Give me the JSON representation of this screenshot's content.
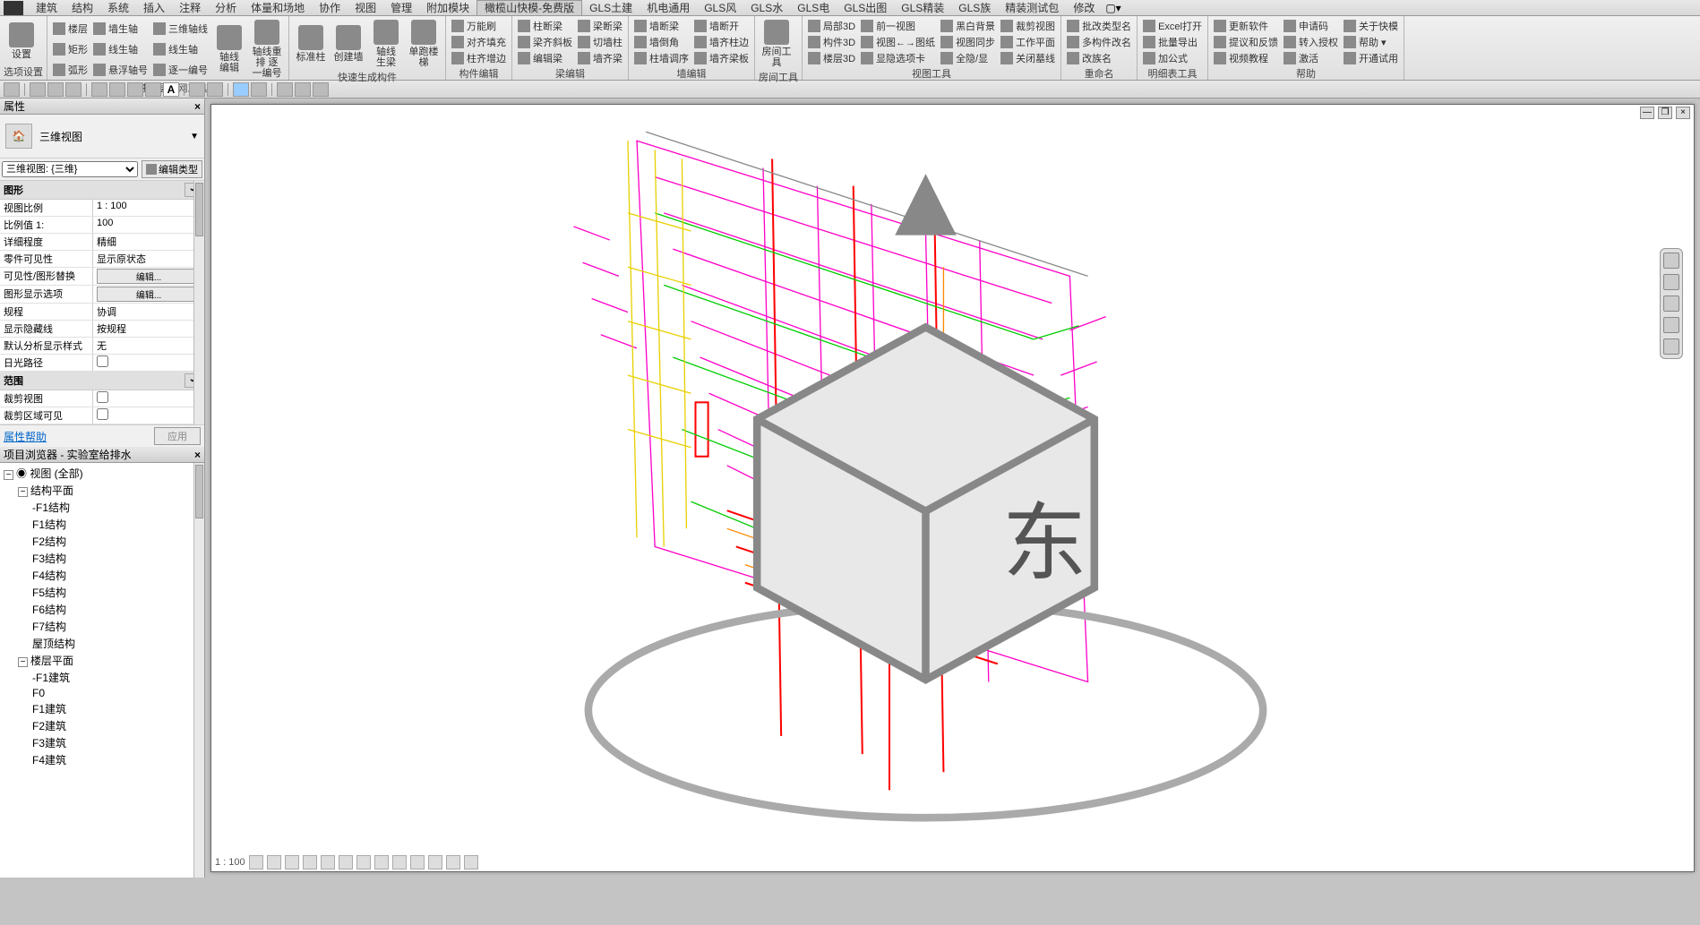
{
  "tabs": [
    "建筑",
    "结构",
    "系统",
    "插入",
    "注释",
    "分析",
    "体量和场地",
    "协作",
    "视图",
    "管理",
    "附加模块",
    "橄榄山快模-免费版",
    "GLS土建",
    "机电通用",
    "GLS风",
    "GLS水",
    "GLS电",
    "GLS出图",
    "GLS精装",
    "GLS族",
    "精装测试包",
    "修改"
  ],
  "active_tab": 11,
  "overflow": "▢▾",
  "ribbon": {
    "g1": {
      "label": "选项设置",
      "big": {
        "label": "设置"
      }
    },
    "g2": {
      "label": "快速楼层轴网工具",
      "c1": [
        "楼层",
        "矩形",
        "弧形"
      ],
      "c2": [
        "墙生轴",
        "线生轴",
        "悬浮轴号"
      ],
      "c3": [
        "三维轴线",
        "线生轴",
        "逐一编号"
      ],
      "big1": {
        "label": "轴线\n编辑"
      },
      "big2": {
        "label": "轴线重排\n逐一编号"
      }
    },
    "g3": {
      "label": "快速生成构件",
      "big1": "标准柱",
      "big2": "创建墙",
      "big3": "轴线\n生梁",
      "big4": "单跑楼梯"
    },
    "g4": {
      "label": "构件编辑",
      "c1": [
        "万能刷",
        "对齐填充",
        "柱齐增边"
      ]
    },
    "g5": {
      "label": "梁编辑",
      "c1": [
        "柱断梁",
        "梁齐斜板",
        "编辑梁"
      ],
      "c2": [
        "梁断梁",
        "切墙柱",
        "墙齐梁"
      ]
    },
    "g6": {
      "label": "墙编辑",
      "c1": [
        "墙断梁",
        "墙倒角",
        "柱墙调序"
      ],
      "c2": [
        "墙断开",
        "墙齐柱边",
        "墙齐梁板"
      ]
    },
    "g7": {
      "label": "房间工具",
      "big": "房间工具"
    },
    "g8": {
      "label": "视图工具",
      "c1": [
        "局部3D",
        "构件3D",
        "楼层3D"
      ],
      "c2": [
        "前一视图",
        "视图←→图纸",
        "显隐选项卡"
      ],
      "c3": [
        "黑白背景",
        "视图同步",
        "全隐/显"
      ],
      "c4": [
        "裁剪视图",
        "工作平面",
        "关闭墓线"
      ]
    },
    "g9": {
      "label": "重命名",
      "c1": [
        "批改类型名",
        "多构件改名",
        "改族名"
      ]
    },
    "g10": {
      "label": "明细表工具",
      "c1": [
        "Excel打开",
        "批量导出",
        "加公式"
      ]
    },
    "g11": {
      "label": "帮助",
      "c1": [
        "更新软件",
        "提议和反馈",
        "视频教程"
      ],
      "c2": [
        "申请码",
        "转入授权",
        "激活"
      ],
      "c3": [
        "关于快模",
        "帮助 ▾",
        "开通试用"
      ]
    }
  },
  "properties": {
    "title": "属性",
    "type_label": "三维视图",
    "instance": "三维视图: {三维}",
    "edit_type": "编辑类型",
    "cats": [
      {
        "name": "图形",
        "rows": [
          {
            "k": "视图比例",
            "v": "1 : 100"
          },
          {
            "k": "比例值 1:",
            "v": "100"
          },
          {
            "k": "详细程度",
            "v": "精细"
          },
          {
            "k": "零件可见性",
            "v": "显示原状态"
          },
          {
            "k": "可见性/图形替换",
            "v": "",
            "btn": "编辑..."
          },
          {
            "k": "图形显示选项",
            "v": "",
            "btn": "编辑..."
          },
          {
            "k": "规程",
            "v": "协调"
          },
          {
            "k": "显示隐藏线",
            "v": "按规程"
          },
          {
            "k": "默认分析显示样式",
            "v": "无"
          },
          {
            "k": "日光路径",
            "v": "",
            "chk": false
          }
        ]
      },
      {
        "name": "范围",
        "rows": [
          {
            "k": "裁剪视图",
            "v": "",
            "chk": false
          },
          {
            "k": "裁剪区域可见",
            "v": "",
            "chk": false
          }
        ]
      }
    ],
    "help": "属性帮助",
    "apply": "应用"
  },
  "browser": {
    "title": "项目浏览器 - 实验室给排水",
    "tree": [
      {
        "l": 0,
        "t": "−",
        "n": "视图 (全部)",
        "ico": true
      },
      {
        "l": 1,
        "t": "−",
        "n": "结构平面"
      },
      {
        "l": 2,
        "n": "-F1结构"
      },
      {
        "l": 2,
        "n": "F1结构"
      },
      {
        "l": 2,
        "n": "F2结构"
      },
      {
        "l": 2,
        "n": "F3结构"
      },
      {
        "l": 2,
        "n": "F4结构"
      },
      {
        "l": 2,
        "n": "F5结构"
      },
      {
        "l": 2,
        "n": "F6结构"
      },
      {
        "l": 2,
        "n": "F7结构"
      },
      {
        "l": 2,
        "n": "屋顶结构"
      },
      {
        "l": 1,
        "t": "−",
        "n": "楼层平面"
      },
      {
        "l": 2,
        "n": "-F1建筑"
      },
      {
        "l": 2,
        "n": "F0"
      },
      {
        "l": 2,
        "n": "F1建筑"
      },
      {
        "l": 2,
        "n": "F2建筑"
      },
      {
        "l": 2,
        "n": "F3建筑"
      },
      {
        "l": 2,
        "n": "F4建筑"
      }
    ]
  },
  "viewcube": {
    "face": "东"
  },
  "statusbar_scale": "1 : 100"
}
